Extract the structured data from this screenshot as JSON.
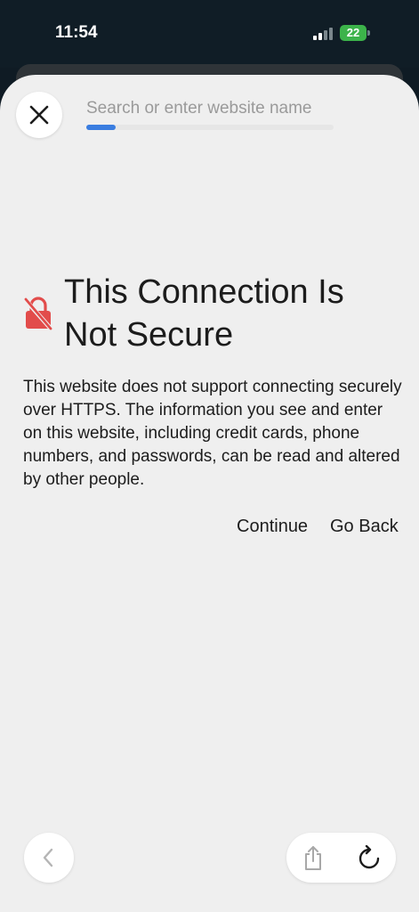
{
  "status_bar": {
    "time": "11:54",
    "battery_level": "22"
  },
  "top_bar": {
    "search_placeholder": "Search or enter website name",
    "load_progress_fraction": 0.12,
    "close_icon": "close-icon"
  },
  "warning": {
    "icon": "lock-slash-icon",
    "icon_color": "#e24c4b",
    "title": "This Connection Is Not Secure",
    "body": "This website does not support connecting securely over HTTPS. The information you see and enter on this website, including credit cards, phone numbers, and passwords, can be read and altered by other people.",
    "continue_label": "Continue",
    "go_back_label": "Go Back"
  },
  "bottom_toolbar": {
    "back_icon": "chevron-left-icon",
    "share_icon": "share-icon",
    "reload_icon": "reload-icon"
  },
  "colors": {
    "accent": "#3a7de0",
    "sheet_background": "#efefef",
    "status_bar_background": "#101d26",
    "battery_green": "#3cb34a"
  }
}
